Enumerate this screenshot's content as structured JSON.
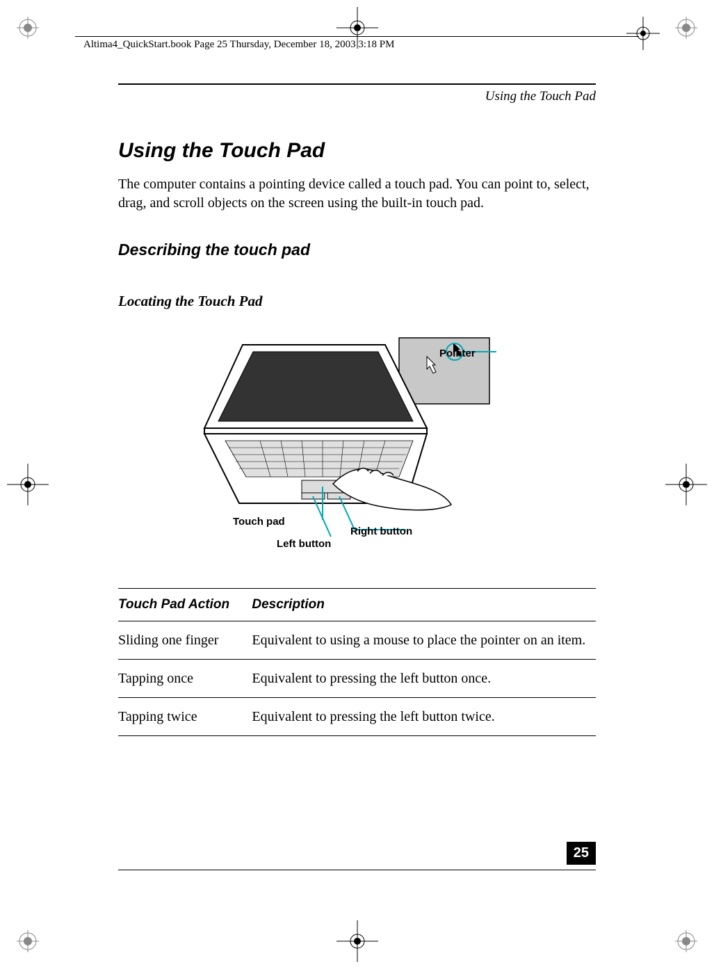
{
  "header": {
    "metadata_line": "Altima4_QuickStart.book  Page 25  Thursday, December 18, 2003  3:18 PM"
  },
  "page": {
    "section_label": "Using the Touch Pad",
    "title": "Using the Touch Pad",
    "intro": "The computer contains a pointing device called a touch pad. You can point to, select, drag, and scroll objects on the screen using the built-in touch pad.",
    "subheading": "Describing the touch pad",
    "subsubheading": "Locating the Touch Pad",
    "number": "25"
  },
  "figure": {
    "labels": {
      "pointer": "Pointer",
      "touch_pad": "Touch pad",
      "left_button": "Left button",
      "right_button": "Right button"
    }
  },
  "table": {
    "headers": {
      "action": "Touch Pad Action",
      "desc": "Description"
    },
    "rows": [
      {
        "action": "Sliding one finger",
        "desc": "Equivalent to using a mouse to place the pointer on an item."
      },
      {
        "action": "Tapping once",
        "desc": "Equivalent to pressing the left button once."
      },
      {
        "action": "Tapping twice",
        "desc": "Equivalent to pressing the left button twice."
      }
    ]
  }
}
